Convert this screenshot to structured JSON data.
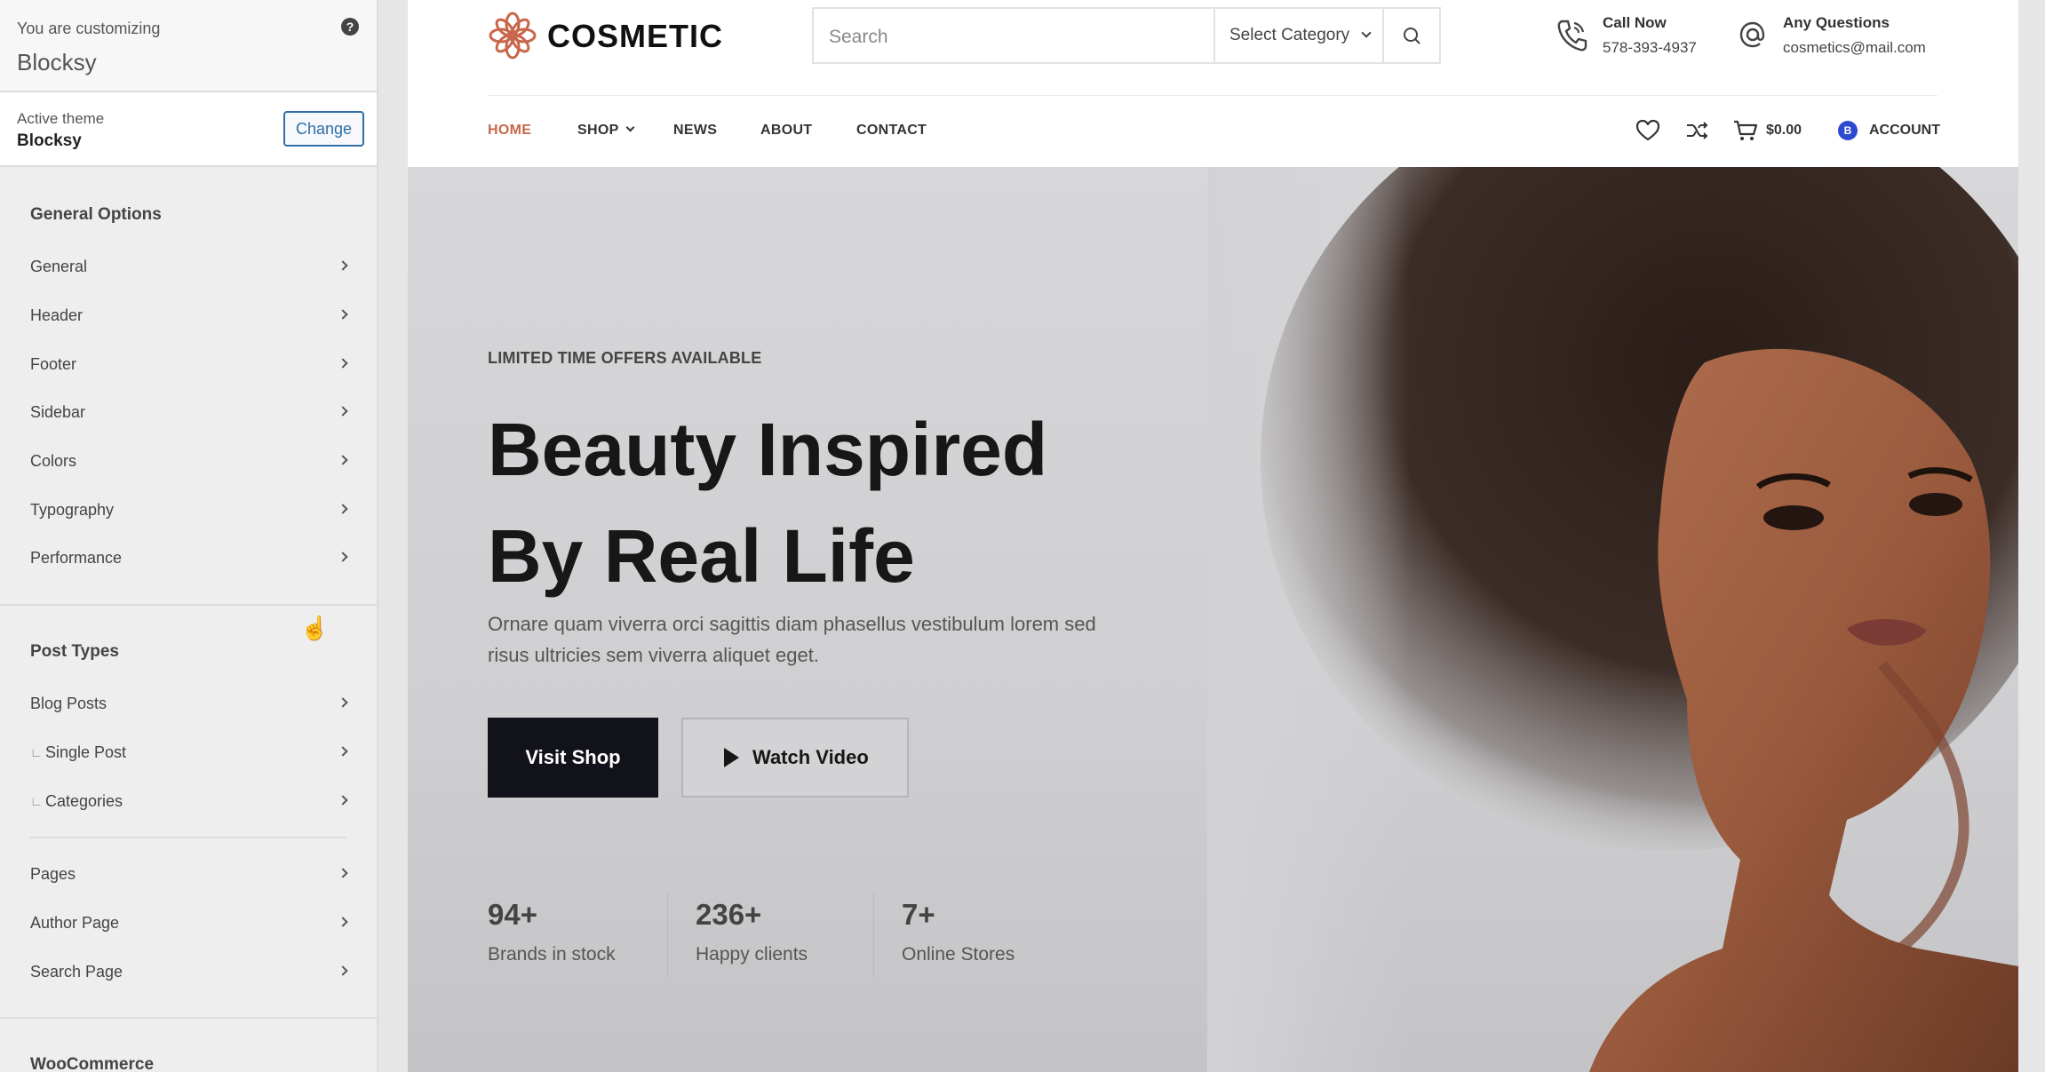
{
  "customizer": {
    "subtitle": "You are customizing",
    "title": "Blocksy",
    "help": "?",
    "active_theme_label": "Active theme",
    "active_theme_name": "Blocksy",
    "change_label": "Change",
    "general_heading": "General Options",
    "general_items": [
      "General",
      "Header",
      "Footer",
      "Sidebar",
      "Colors",
      "Typography",
      "Performance"
    ],
    "post_types_heading": "Post Types",
    "post_items": [
      "Blog Posts",
      "Single Post",
      "Categories"
    ],
    "page_items": [
      "Pages",
      "Author Page",
      "Search Page"
    ],
    "woo_heading": "WooCommerce"
  },
  "site": {
    "brand": "COSMETIC",
    "search_placeholder": "Search",
    "category_label": "Select Category",
    "call_title": "Call Now",
    "call_value": "578-393-4937",
    "question_title": "Any Questions",
    "question_value": "cosmetics@mail.com",
    "nav": [
      "HOME",
      "SHOP",
      "NEWS",
      "ABOUT",
      "CONTACT"
    ],
    "cart_total": "$0.00",
    "account_badge": "B",
    "account_label": "ACCOUNT",
    "accent_color": "#c8674b",
    "hero": {
      "eyebrow": "LIMITED TIME OFFERS AVAILABLE",
      "headline_1": "Beauty Inspired",
      "headline_2": "By Real Life",
      "lead": "Ornare quam viverra orci sagittis diam phasellus vestibulum lorem sed risus ultricies sem viverra aliquet eget.",
      "primary_cta": "Visit Shop",
      "secondary_cta": "Watch Video",
      "stats": [
        {
          "num": "94+",
          "label": "Brands in stock"
        },
        {
          "num": "236+",
          "label": "Happy clients"
        },
        {
          "num": "7+",
          "label": "Online Stores"
        }
      ]
    }
  }
}
